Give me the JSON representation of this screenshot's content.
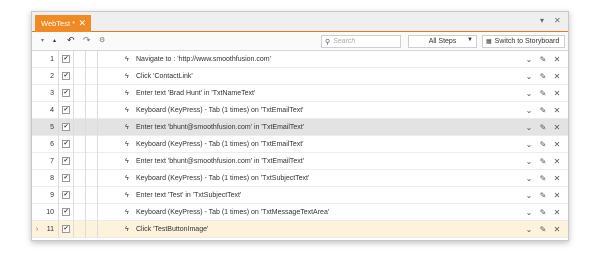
{
  "tab": {
    "title": "WebTest *",
    "close": "✕"
  },
  "window_controls": {
    "dropdown": "▾",
    "close": "✕"
  },
  "toolbar": {
    "search_placeholder": "Search",
    "filter_selected": "All Steps",
    "storyboard_label": "Switch to Storyboard"
  },
  "steps": [
    {
      "num": "1",
      "text": "Navigate to : 'http://www.smoothfusion.com'"
    },
    {
      "num": "2",
      "text": "Click 'ContactLink'"
    },
    {
      "num": "3",
      "text": "Enter text 'Brad Hunt' in 'TxtNameText'"
    },
    {
      "num": "4",
      "text": "Keyboard (KeyPress) - Tab (1 times) on 'TxtEmailText'"
    },
    {
      "num": "5",
      "text": "Enter text 'bhunt@smoothfusion.com' in 'TxtEmailText'"
    },
    {
      "num": "6",
      "text": "Keyboard (KeyPress) - Tab (1 times) on 'TxtEmailText'"
    },
    {
      "num": "7",
      "text": "Enter text 'bhunt@smoothfusion.com' in 'TxtEmailText'"
    },
    {
      "num": "8",
      "text": "Keyboard (KeyPress) - Tab (1 times) on 'TxtSubjectText'"
    },
    {
      "num": "9",
      "text": "Enter text 'Test' in 'TxtSubjectText'"
    },
    {
      "num": "10",
      "text": "Keyboard (KeyPress) - Tab (1 times) on 'TxtMessageTextArea'"
    },
    {
      "num": "11",
      "text": "Click 'TestButtonImage'"
    }
  ],
  "colors": {
    "accent": "#f08a24",
    "selected_row": "#e3e3e3",
    "current_row": "#fdf2dc"
  },
  "icons": {
    "step": "lightning-icon",
    "expand": "chevron-down-icon",
    "edit": "pencil-icon",
    "delete": "close-icon",
    "current": "chevron-right-icon"
  }
}
